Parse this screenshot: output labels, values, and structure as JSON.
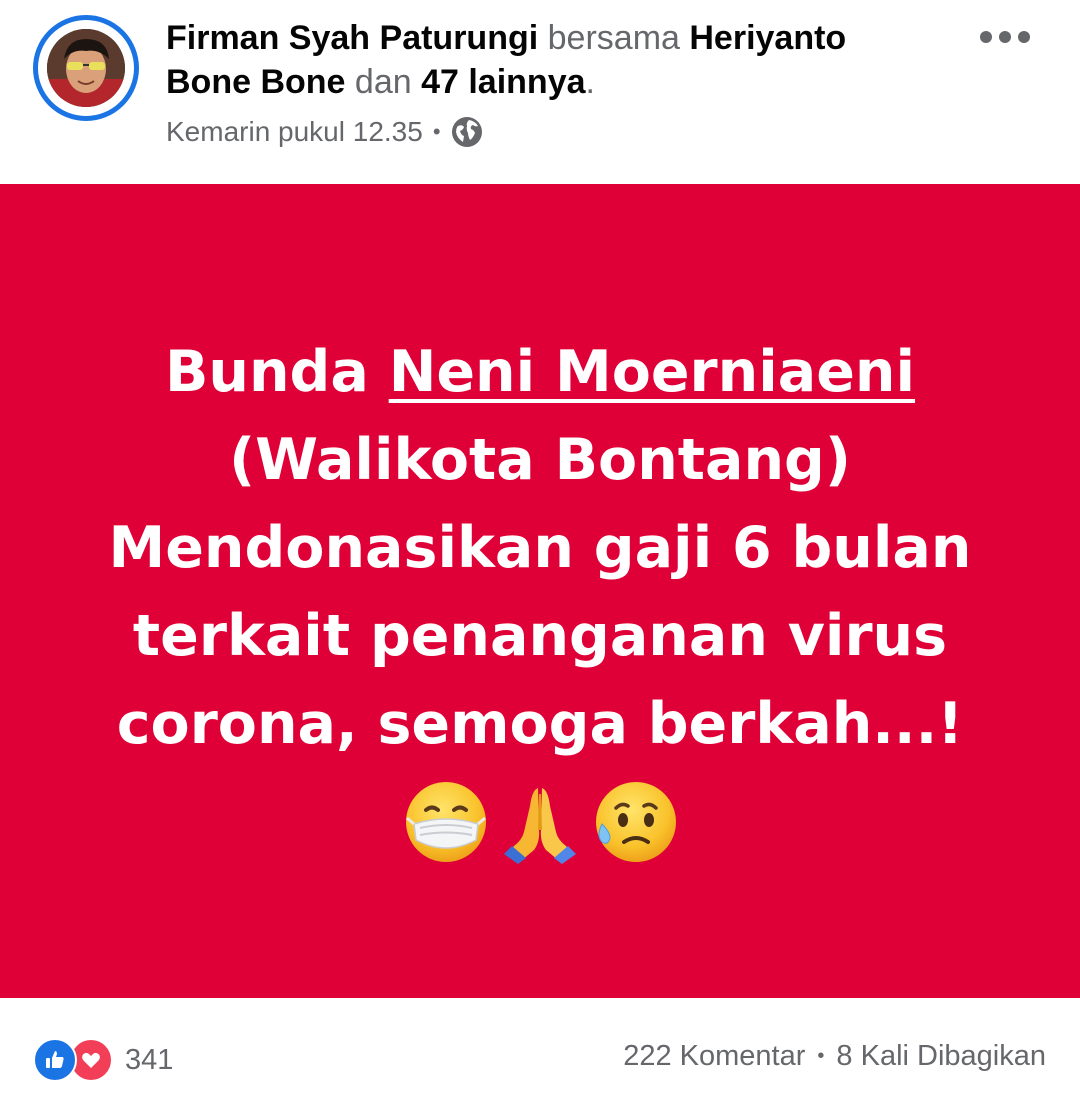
{
  "post": {
    "author": "Firman Syah Paturungi",
    "with_word": "bersama",
    "tagged": "Heriyanto Bone Bone",
    "and_word": "dan",
    "others": "47 lainnya",
    "period": ".",
    "timestamp": "Kemarin pukul 12.35",
    "meta_separator": "•",
    "privacy_icon": "globe-icon",
    "menu_icon": "more-options-icon"
  },
  "content": {
    "background_color": "#df0037",
    "text_color": "#ffffff",
    "line1_prefix": "Bunda",
    "line1_mention": "Neni Moerniaeni",
    "line2": "(Walikota Bontang)",
    "line3": "Mendonasikan gaji 6 bulan",
    "line4": "terkait penanganan virus",
    "line5": "corona, semoga berkah...!",
    "emojis": [
      "face-with-medical-mask",
      "folded-hands",
      "sad-but-relieved-face"
    ]
  },
  "footer": {
    "reaction_icons": [
      "like-icon",
      "love-icon"
    ],
    "reaction_count": "341",
    "comments": "222 Komentar",
    "separator": "•",
    "shares": "8 Kali Dibagikan",
    "like_color": "#1b74e4",
    "love_color": "#f33e58"
  }
}
